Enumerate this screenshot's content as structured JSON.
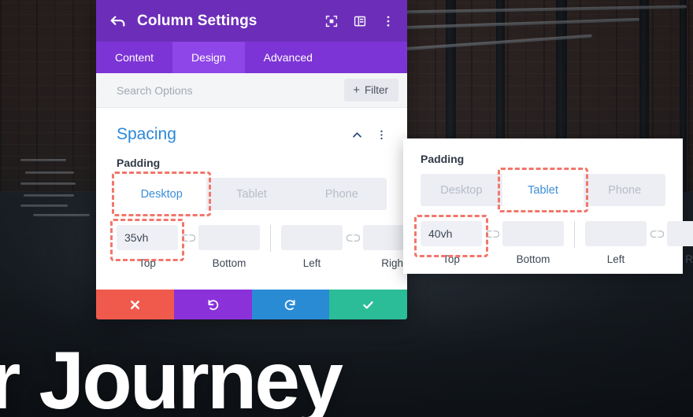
{
  "background": {
    "hero_text": "r Journey",
    "scene": "gym-brick-wall-photo"
  },
  "modal": {
    "header": {
      "back_icon": "back-arrow-icon",
      "title": "Column Settings",
      "icons": [
        {
          "name": "focus-frame-icon"
        },
        {
          "name": "layout-panel-icon"
        },
        {
          "name": "more-options-icon"
        }
      ]
    },
    "tabs": [
      {
        "label": "Content",
        "active": false
      },
      {
        "label": "Design",
        "active": true
      },
      {
        "label": "Advanced",
        "active": false
      }
    ],
    "search": {
      "placeholder": "Search Options",
      "value": "",
      "filter_label": "Filter",
      "filter_icon": "plus-icon"
    },
    "section": {
      "title": "Spacing",
      "collapse_icon": "chevron-up-icon",
      "menu_icon": "more-options-icon"
    },
    "padding": {
      "label": "Padding",
      "devices": [
        {
          "label": "Desktop",
          "active": true,
          "highlighted": true
        },
        {
          "label": "Tablet",
          "active": false,
          "highlighted": false
        },
        {
          "label": "Phone",
          "active": false,
          "highlighted": false
        }
      ],
      "fields": [
        {
          "label": "Top",
          "value": "35vh",
          "highlighted": true
        },
        {
          "label": "Bottom",
          "value": "",
          "highlighted": false
        },
        {
          "label": "Left",
          "value": "",
          "highlighted": false
        },
        {
          "label": "Right",
          "value": "",
          "highlighted": false
        }
      ],
      "link_icon": "broken-link-icon"
    },
    "footer": [
      {
        "name": "cancel-button",
        "icon": "close-x-icon",
        "color": "#ef5a4c"
      },
      {
        "name": "undo-button",
        "icon": "undo-arrow-icon",
        "color": "#8b31da"
      },
      {
        "name": "redo-button",
        "icon": "redo-arrow-icon",
        "color": "#2a8bd5"
      },
      {
        "name": "save-button",
        "icon": "checkmark-icon",
        "color": "#2bbd97"
      }
    ]
  },
  "right_card": {
    "padding": {
      "label": "Padding",
      "devices": [
        {
          "label": "Desktop",
          "active": false,
          "highlighted": false
        },
        {
          "label": "Tablet",
          "active": true,
          "highlighted": true
        },
        {
          "label": "Phone",
          "active": false,
          "highlighted": false
        }
      ],
      "fields": [
        {
          "label": "Top",
          "value": "40vh",
          "highlighted": true
        },
        {
          "label": "Bottom",
          "value": "",
          "highlighted": false
        },
        {
          "label": "Left",
          "value": "",
          "highlighted": false
        },
        {
          "label": "Right",
          "value": "",
          "highlighted": false
        }
      ],
      "link_icon": "broken-link-icon"
    }
  },
  "colors": {
    "header_purple": "#6c2eb9",
    "tab_purple": "#7d34d6",
    "tab_active_purple": "#8e46e8",
    "section_blue": "#2b87da",
    "active_device_blue": "#3b8ed8",
    "highlight_red": "#f2766b"
  }
}
